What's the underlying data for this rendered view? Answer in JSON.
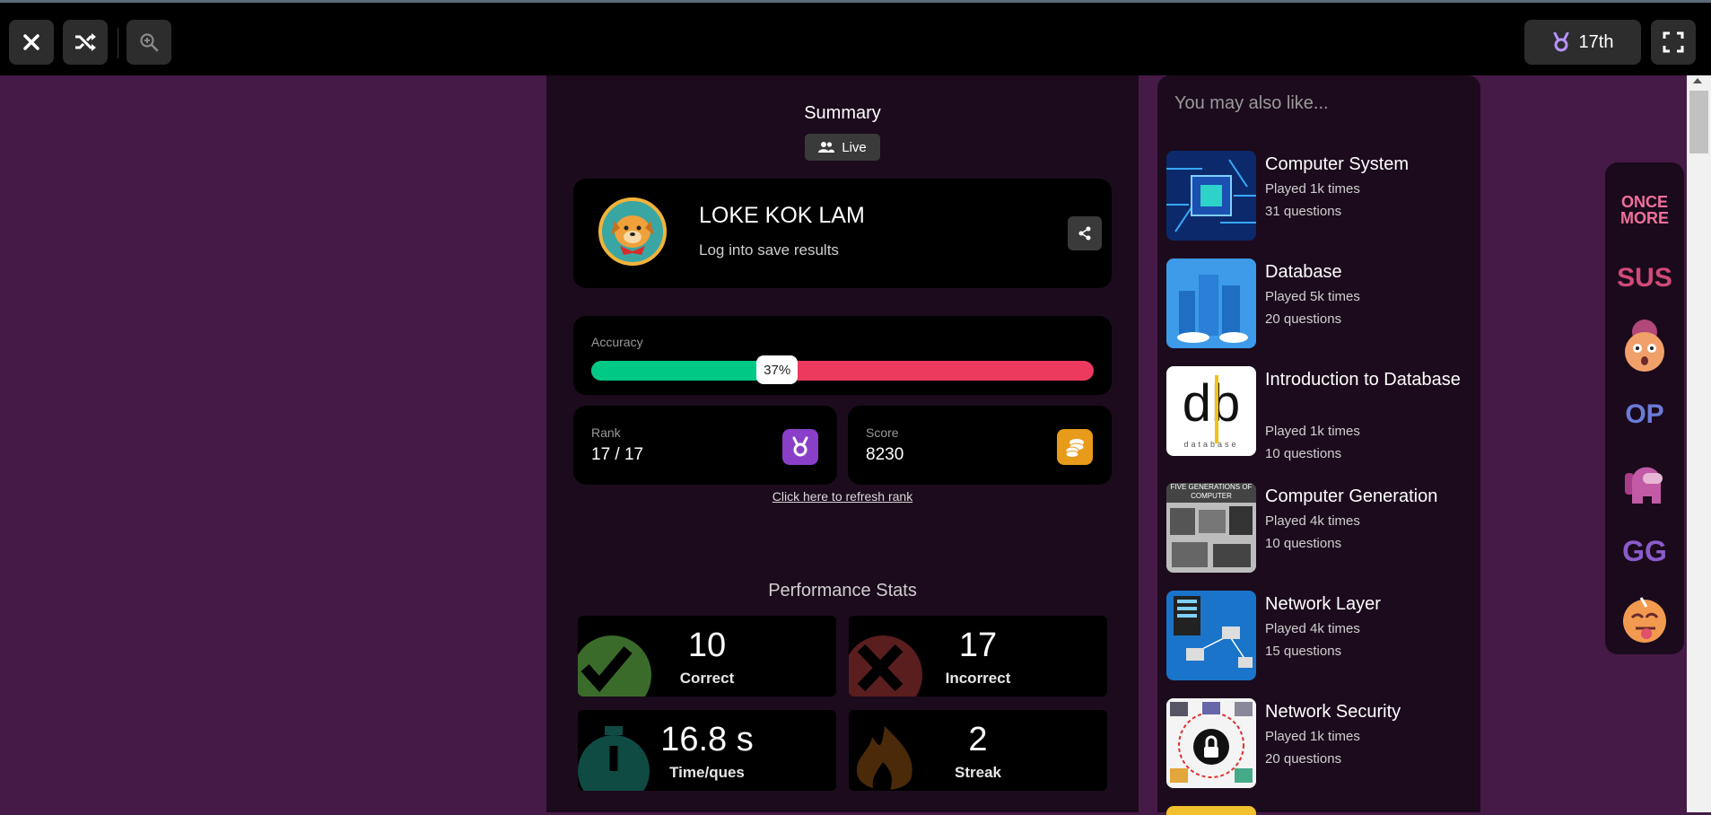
{
  "topbar": {
    "close": "close-icon",
    "skip": "shuffle-icon",
    "zoom": "zoom-in-icon",
    "rank_label": "17th",
    "fullscreen": "fullscreen-icon"
  },
  "summary": {
    "title": "Summary",
    "mode": "Live",
    "player": {
      "name": "LOKE KOK LAM",
      "subtitle": "Log into save results"
    },
    "accuracy": {
      "label": "Accuracy",
      "percent_text": "37%",
      "fraction": 0.37
    },
    "rank": {
      "label": "Rank",
      "value": "17 / 17"
    },
    "score": {
      "label": "Score",
      "value": "8230"
    },
    "refresh_link": "Click here to refresh rank",
    "colors": {
      "correct": "#00c985",
      "incorrect": "#ec3a5f",
      "rank_icon": "#8a3fc9",
      "score_icon": "#e89a1a"
    }
  },
  "performance": {
    "title": "Performance Stats",
    "stats": [
      {
        "value": "10",
        "label": "Correct",
        "icon": "check-icon"
      },
      {
        "value": "17",
        "label": "Incorrect",
        "icon": "cross-icon"
      },
      {
        "value": "16.8 s",
        "label": "Time/ques",
        "icon": "stopwatch-icon"
      },
      {
        "value": "2",
        "label": "Streak",
        "icon": "fire-icon"
      }
    ]
  },
  "recommendations": {
    "title": "You may also like...",
    "items": [
      {
        "title": "Computer System",
        "played": "Played 1k times",
        "questions": "31 questions"
      },
      {
        "title": "Database",
        "played": "Played 5k times",
        "questions": "20 questions"
      },
      {
        "title": "Introduction to Database",
        "played": "Played 1k times",
        "questions": "10 questions"
      },
      {
        "title": "Computer Generation",
        "played": "Played 4k times",
        "questions": "10 questions"
      },
      {
        "title": "Network Layer",
        "played": "Played 4k times",
        "questions": "15 questions"
      },
      {
        "title": "Network Security",
        "played": "Played 1k times",
        "questions": "20 questions"
      }
    ],
    "thumb_texts": {
      "db_logo": "db",
      "db_caption": "database",
      "gen_caption": "FIVE GENERATIONS OF COMPUTER"
    }
  },
  "stickers": {
    "items": [
      "ONCE MORE",
      "SUS",
      "shocked-face-icon",
      "OP",
      "crewmate-icon",
      "GG",
      "tongue-face-icon"
    ],
    "once_more_l1": "ONCE",
    "once_more_l2": "MORE",
    "sus": "SUS",
    "op": "OP",
    "gg": "GG"
  }
}
